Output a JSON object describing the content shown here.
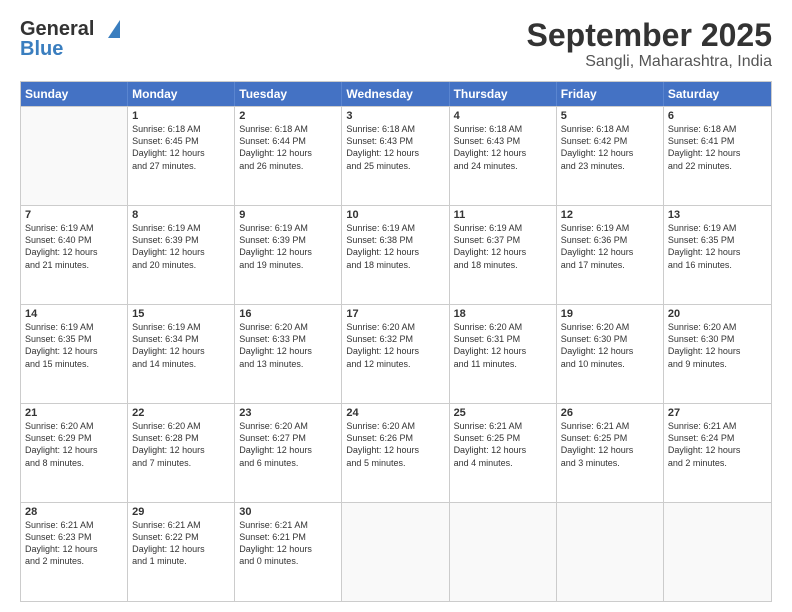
{
  "logo": {
    "general": "General",
    "blue": "Blue"
  },
  "title": "September 2025",
  "subtitle": "Sangli, Maharashtra, India",
  "header_days": [
    "Sunday",
    "Monday",
    "Tuesday",
    "Wednesday",
    "Thursday",
    "Friday",
    "Saturday"
  ],
  "rows": [
    [
      {
        "day": "",
        "info": ""
      },
      {
        "day": "1",
        "info": "Sunrise: 6:18 AM\nSunset: 6:45 PM\nDaylight: 12 hours\nand 27 minutes."
      },
      {
        "day": "2",
        "info": "Sunrise: 6:18 AM\nSunset: 6:44 PM\nDaylight: 12 hours\nand 26 minutes."
      },
      {
        "day": "3",
        "info": "Sunrise: 6:18 AM\nSunset: 6:43 PM\nDaylight: 12 hours\nand 25 minutes."
      },
      {
        "day": "4",
        "info": "Sunrise: 6:18 AM\nSunset: 6:43 PM\nDaylight: 12 hours\nand 24 minutes."
      },
      {
        "day": "5",
        "info": "Sunrise: 6:18 AM\nSunset: 6:42 PM\nDaylight: 12 hours\nand 23 minutes."
      },
      {
        "day": "6",
        "info": "Sunrise: 6:18 AM\nSunset: 6:41 PM\nDaylight: 12 hours\nand 22 minutes."
      }
    ],
    [
      {
        "day": "7",
        "info": "Sunrise: 6:19 AM\nSunset: 6:40 PM\nDaylight: 12 hours\nand 21 minutes."
      },
      {
        "day": "8",
        "info": "Sunrise: 6:19 AM\nSunset: 6:39 PM\nDaylight: 12 hours\nand 20 minutes."
      },
      {
        "day": "9",
        "info": "Sunrise: 6:19 AM\nSunset: 6:39 PM\nDaylight: 12 hours\nand 19 minutes."
      },
      {
        "day": "10",
        "info": "Sunrise: 6:19 AM\nSunset: 6:38 PM\nDaylight: 12 hours\nand 18 minutes."
      },
      {
        "day": "11",
        "info": "Sunrise: 6:19 AM\nSunset: 6:37 PM\nDaylight: 12 hours\nand 18 minutes."
      },
      {
        "day": "12",
        "info": "Sunrise: 6:19 AM\nSunset: 6:36 PM\nDaylight: 12 hours\nand 17 minutes."
      },
      {
        "day": "13",
        "info": "Sunrise: 6:19 AM\nSunset: 6:35 PM\nDaylight: 12 hours\nand 16 minutes."
      }
    ],
    [
      {
        "day": "14",
        "info": "Sunrise: 6:19 AM\nSunset: 6:35 PM\nDaylight: 12 hours\nand 15 minutes."
      },
      {
        "day": "15",
        "info": "Sunrise: 6:19 AM\nSunset: 6:34 PM\nDaylight: 12 hours\nand 14 minutes."
      },
      {
        "day": "16",
        "info": "Sunrise: 6:20 AM\nSunset: 6:33 PM\nDaylight: 12 hours\nand 13 minutes."
      },
      {
        "day": "17",
        "info": "Sunrise: 6:20 AM\nSunset: 6:32 PM\nDaylight: 12 hours\nand 12 minutes."
      },
      {
        "day": "18",
        "info": "Sunrise: 6:20 AM\nSunset: 6:31 PM\nDaylight: 12 hours\nand 11 minutes."
      },
      {
        "day": "19",
        "info": "Sunrise: 6:20 AM\nSunset: 6:30 PM\nDaylight: 12 hours\nand 10 minutes."
      },
      {
        "day": "20",
        "info": "Sunrise: 6:20 AM\nSunset: 6:30 PM\nDaylight: 12 hours\nand 9 minutes."
      }
    ],
    [
      {
        "day": "21",
        "info": "Sunrise: 6:20 AM\nSunset: 6:29 PM\nDaylight: 12 hours\nand 8 minutes."
      },
      {
        "day": "22",
        "info": "Sunrise: 6:20 AM\nSunset: 6:28 PM\nDaylight: 12 hours\nand 7 minutes."
      },
      {
        "day": "23",
        "info": "Sunrise: 6:20 AM\nSunset: 6:27 PM\nDaylight: 12 hours\nand 6 minutes."
      },
      {
        "day": "24",
        "info": "Sunrise: 6:20 AM\nSunset: 6:26 PM\nDaylight: 12 hours\nand 5 minutes."
      },
      {
        "day": "25",
        "info": "Sunrise: 6:21 AM\nSunset: 6:25 PM\nDaylight: 12 hours\nand 4 minutes."
      },
      {
        "day": "26",
        "info": "Sunrise: 6:21 AM\nSunset: 6:25 PM\nDaylight: 12 hours\nand 3 minutes."
      },
      {
        "day": "27",
        "info": "Sunrise: 6:21 AM\nSunset: 6:24 PM\nDaylight: 12 hours\nand 2 minutes."
      }
    ],
    [
      {
        "day": "28",
        "info": "Sunrise: 6:21 AM\nSunset: 6:23 PM\nDaylight: 12 hours\nand 2 minutes."
      },
      {
        "day": "29",
        "info": "Sunrise: 6:21 AM\nSunset: 6:22 PM\nDaylight: 12 hours\nand 1 minute."
      },
      {
        "day": "30",
        "info": "Sunrise: 6:21 AM\nSunset: 6:21 PM\nDaylight: 12 hours\nand 0 minutes."
      },
      {
        "day": "",
        "info": ""
      },
      {
        "day": "",
        "info": ""
      },
      {
        "day": "",
        "info": ""
      },
      {
        "day": "",
        "info": ""
      }
    ]
  ]
}
